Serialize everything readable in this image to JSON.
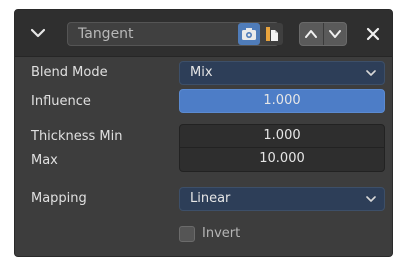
{
  "header": {
    "name": "Tangent",
    "realtime_icon": "camera-icon",
    "render_icon": "render-icon"
  },
  "fields": {
    "blend_mode": {
      "label": "Blend Mode",
      "value": "Mix"
    },
    "influence": {
      "label": "Influence",
      "value": "1.000",
      "fraction": 1.0
    },
    "thickness_min": {
      "label": "Thickness Min",
      "value": "1.000"
    },
    "thickness_max": {
      "label": "Max",
      "value": "10.000"
    },
    "mapping": {
      "label": "Mapping",
      "value": "Linear"
    },
    "invert": {
      "label": "Invert",
      "checked": false
    }
  },
  "colors": {
    "accent": "#4d7dc7",
    "panel_bg": "#3d3d3d",
    "dropdown_bg": "#2d3e58"
  }
}
